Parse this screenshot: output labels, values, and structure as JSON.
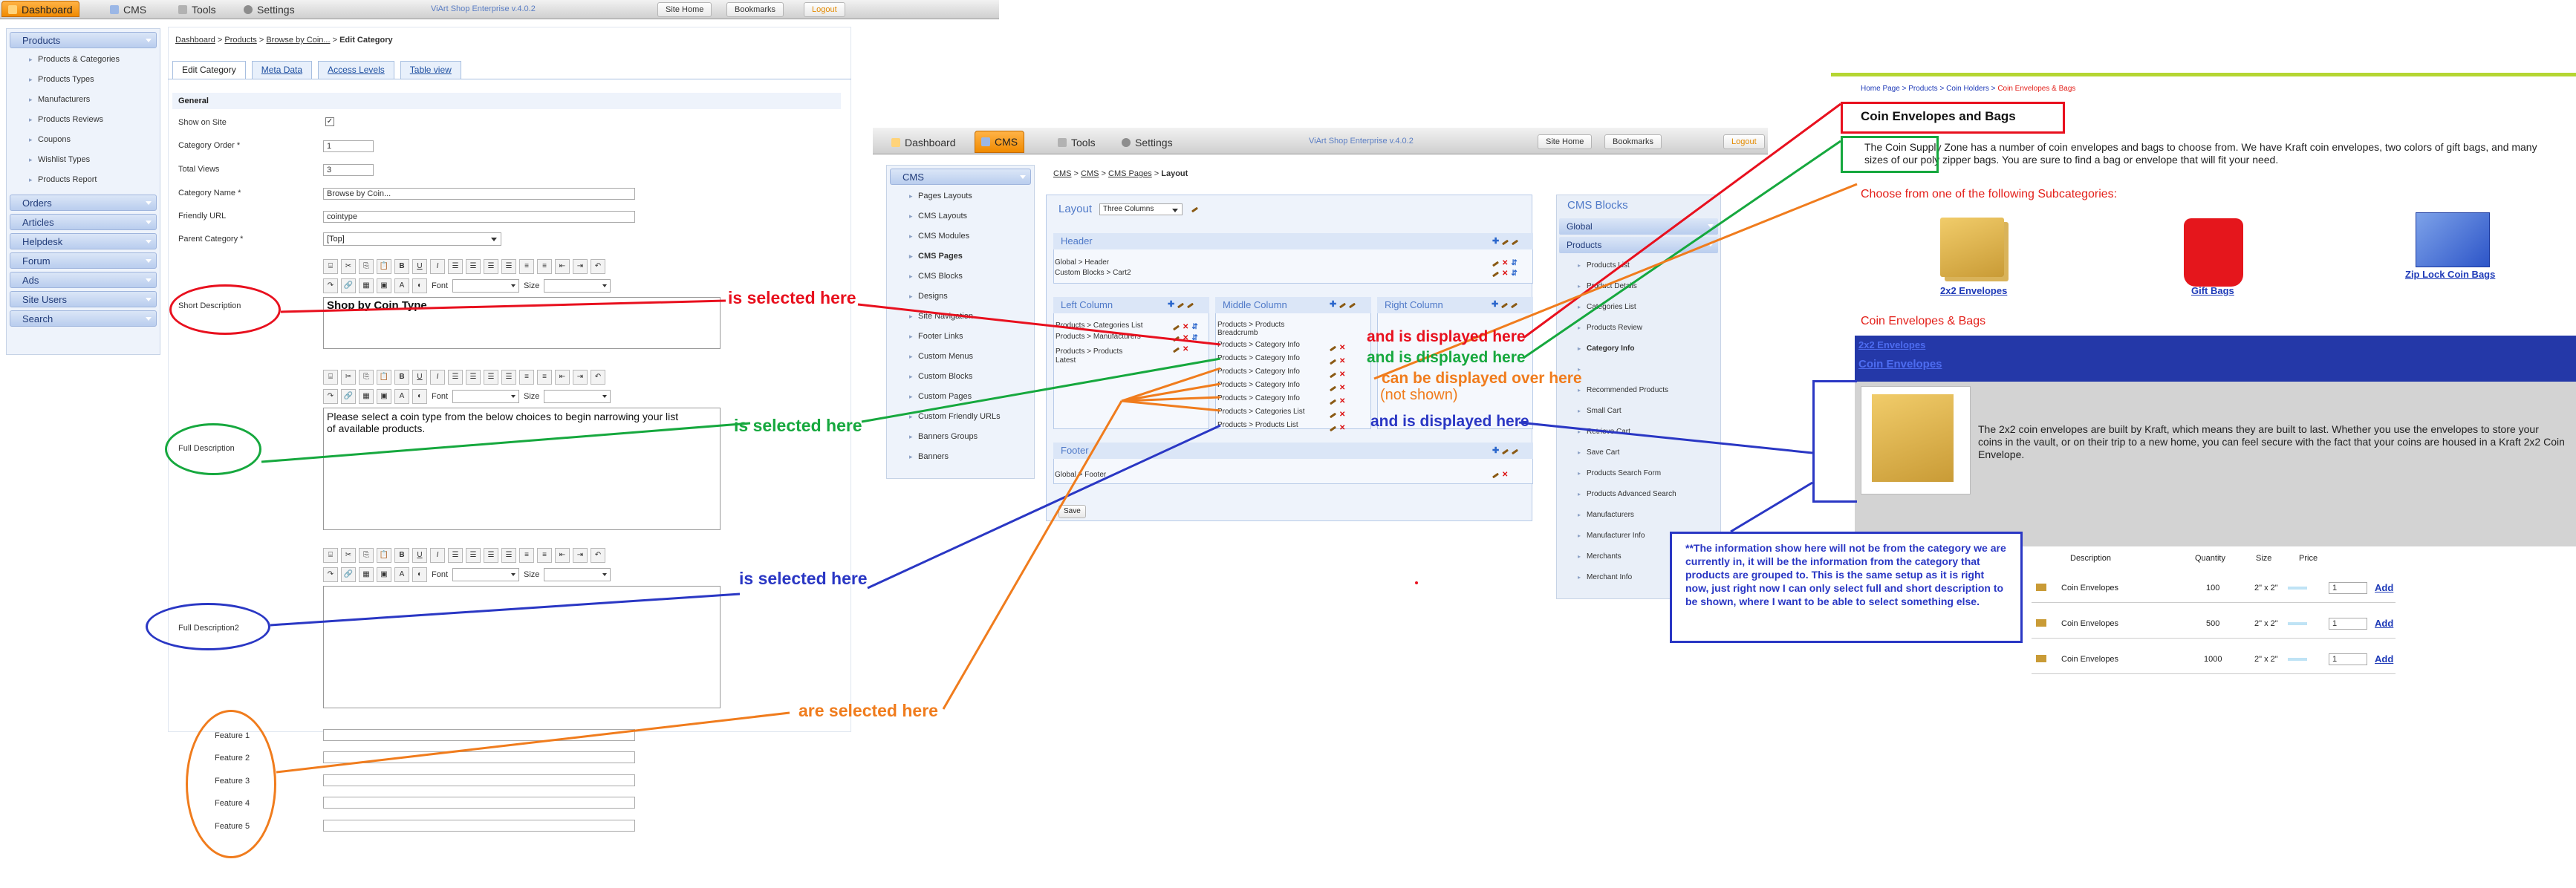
{
  "admin": {
    "tabs": [
      {
        "label": "Dashboard",
        "icon": "dashboard-icon"
      },
      {
        "label": "CMS",
        "icon": "cms-icon"
      },
      {
        "label": "Tools",
        "icon": "tools-icon"
      },
      {
        "label": "Settings",
        "icon": "settings-icon"
      }
    ],
    "version": "ViArt Shop Enterprise v.4.0.2",
    "buttons": {
      "site_home": "Site Home",
      "bookmarks": "Bookmarks",
      "logout": "Logout"
    },
    "sidebar": {
      "products_header": "Products",
      "items": [
        "Products & Categories",
        "Products Types",
        "Manufacturers",
        "Products Reviews",
        "Coupons",
        "Wishlist Types",
        "Products Report"
      ],
      "groups": [
        "Orders",
        "Articles",
        "Helpdesk",
        "Forum",
        "Ads",
        "Site Users",
        "Search"
      ]
    },
    "breadcrumb": {
      "a": "Dashboard",
      "sep": " > ",
      "b": "Products",
      "c": "Browse by Coin...",
      "d": "Edit Category"
    },
    "tabs_form": [
      "Edit Category",
      "Meta Data",
      "Access Levels",
      "Table view"
    ],
    "form": {
      "section": "General",
      "show_on_site_label": "Show on Site",
      "show_on_site_value": "✓",
      "category_order_label": "Category Order *",
      "category_order_value": "1",
      "total_views_label": "Total Views",
      "total_views_value": "3",
      "category_name_label": "Category Name *",
      "category_name_value": "Browse by Coin...",
      "friendly_url_label": "Friendly URL",
      "friendly_url_value": "cointype",
      "parent_category_label": "Parent Category *",
      "parent_category_value": "[Top]",
      "short_description_label": "Short Description",
      "short_description_value": "Shop by Coin Type...",
      "full_description_label": "Full Description",
      "full_description_value": "Please select a coin type from the below choices to begin narrowing your list\nof available products.",
      "full_description2_label": "Full Description2",
      "features": [
        "Feature 1",
        "Feature 2",
        "Feature 3",
        "Feature 4",
        "Feature 5"
      ],
      "font_label": "Font",
      "size_label": "Size"
    }
  },
  "cms": {
    "tabs": [
      {
        "label": "Dashboard",
        "icon": "dashboard-icon"
      },
      {
        "label": "CMS",
        "icon": "cms-icon"
      },
      {
        "label": "Tools",
        "icon": "tools-icon"
      },
      {
        "label": "Settings",
        "icon": "settings-icon"
      }
    ],
    "version": "ViArt Shop Enterprise v.4.0.2",
    "buttons": {
      "site_home": "Site Home",
      "bookmarks": "Bookmarks",
      "logout": "Logout"
    },
    "sidebar_header": "CMS",
    "sidebar_items": [
      "Pages Layouts",
      "CMS Layouts",
      "CMS Modules",
      "CMS Pages",
      "CMS Blocks",
      "Designs",
      "Site Navigation",
      "Footer Links",
      "Custom Menus",
      "Custom Blocks",
      "Custom Pages",
      "Custom Friendly URLs",
      "Banners Groups",
      "Banners"
    ],
    "breadcrumb": {
      "a": "CMS",
      "b": "CMS",
      "c": "CMS Pages",
      "d": "Layout"
    },
    "layout_label": "Layout",
    "layout_value": "Three Columns",
    "header_label": "Header",
    "header_rows": [
      "Global > Header",
      "Custom Blocks > Cart2"
    ],
    "left_label": "Left Column",
    "left_rows": [
      "Products > Categories List",
      "Products > Manufacturers",
      "Products > Products",
      "Latest"
    ],
    "middle_label": "Middle Column",
    "middle_rows": [
      "Products > Products",
      "Breadcrumb",
      "Products > Category Info",
      "Products > Category Info",
      "Products > Category Info",
      "Products > Category Info",
      "Products > Category Info",
      "Products > Categories List",
      "Products > Products List"
    ],
    "right_label": "Right Column",
    "footer_label": "Footer",
    "footer_rows": [
      "Global > Footer"
    ],
    "save_label": "Save",
    "blocks_title": "CMS Blocks",
    "blocks_global": "Global",
    "blocks_products": "Products",
    "blocks_items": [
      "Products List",
      "Product Details",
      "Categories List",
      "Products Review",
      "Category Info",
      "",
      "Recommended Products",
      "Small Cart",
      "Retrieve Cart",
      "Save Cart",
      "Products Search Form",
      "Products Advanced Search",
      "Manufacturers",
      "Manufacturer Info",
      "Merchants",
      "Merchant Info"
    ]
  },
  "store": {
    "breadcrumb": {
      "a": "Home Page",
      "b": "Products",
      "c": "Coin Holders",
      "d": "Coin Envelopes & Bags"
    },
    "title": "Coin Envelopes and Bags",
    "description": "The Coin Supply Zone has a number of coin envelopes and bags to choose from. We have Kraft coin envelopes, two colors of gift bags, and many sizes of our poly zipper bags. You are sure to find a bag or envelope that will fit your need.",
    "subcat_heading": "Choose from one of the following Subcategories:",
    "subcats": [
      "2x2 Envelopes",
      "Gift Bags",
      "Zip Lock Coin Bags"
    ],
    "section_title": "Coin Envelopes & Bags",
    "blue_line1": "2x2 Envelopes",
    "blue_line2": "Coin Envelopes",
    "item_description": "The 2x2 coin envelopes are built by Kraft, which means they are built to last. Whether you use the envelopes to store your coins in the vault, or on their trip to a new home, you can feel secure with the fact that your coins are housed in a Kraft 2x2 Coin Envelope.",
    "table": {
      "headers": [
        "Description",
        "Quantity",
        "Size",
        "Price"
      ],
      "rows": [
        {
          "desc": "Coin Envelopes",
          "qty": "100",
          "size": "2\" x 2\"",
          "amount": "1",
          "add": "Add"
        },
        {
          "desc": "Coin Envelopes",
          "qty": "500",
          "size": "2\" x 2\"",
          "amount": "1",
          "add": "Add"
        },
        {
          "desc": "Coin Envelopes",
          "qty": "1000",
          "size": "2\" x 2\"",
          "amount": "1",
          "add": "Add"
        }
      ]
    },
    "note": "**The information show here will not be from the category we are currently in, it will be the information from the category that products are grouped to.  This is the same setup as it is right now, just right now I can only select full and short description to be shown, where I want to be able to select  something else."
  },
  "annotations": {
    "red_left": "is selected here",
    "red_right": "and is displayed here",
    "green_left": "is selected here",
    "green_right": "and is displayed here",
    "orange_right": "can be displayed over here",
    "orange_right2": "(not shown)",
    "orange_left": "are selected here",
    "blue_left": "is selected here",
    "blue_right": "and is displayed here"
  },
  "colors": {
    "red": "#e8101e",
    "green": "#16a83e",
    "blue": "#2a37c4",
    "orange": "#f07c1d",
    "accent": "#f08a00",
    "store_blue": "#1f3bb8"
  }
}
